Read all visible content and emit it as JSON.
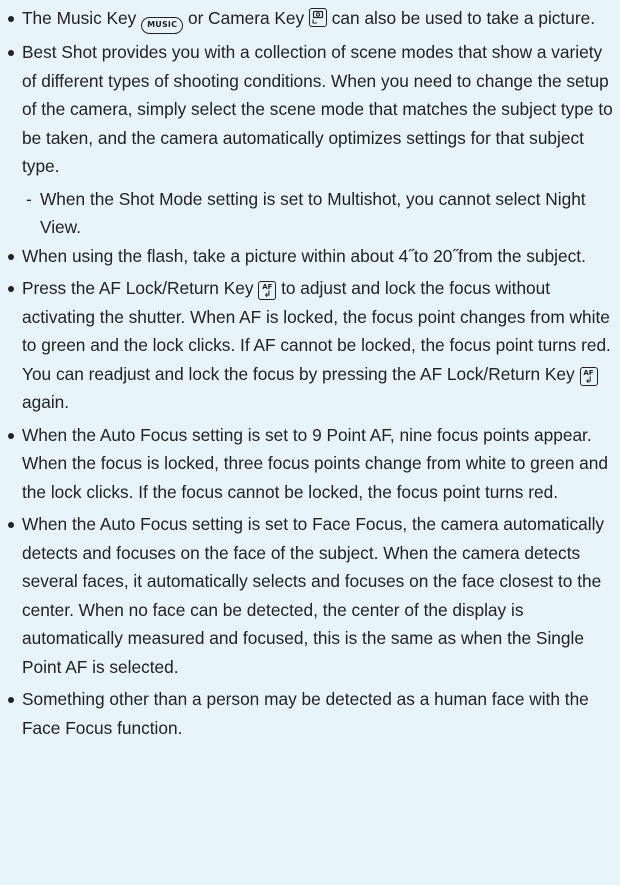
{
  "notes": [
    {
      "text_a": "The Music Key ",
      "key_a": "MUSIC",
      "text_b": " or Camera Key ",
      "text_c": " can also be used to take a picture."
    },
    {
      "text": "Best Shot provides you with a collection of scene modes that show a variety of different types of shooting conditions. When you need to change the setup of the camera, simply select the scene mode that matches the subject type to be taken, and the camera automatically optimizes settings for that subject type.",
      "sub": "When the Shot Mode setting is set to Multishot, you cannot select Night View."
    },
    {
      "text": "When using the flash, take a picture within about 4˝to 20˝from the subject."
    },
    {
      "text_a": "Press the AF Lock/Return Key ",
      "text_b": " to adjust and lock the focus without activating the shutter. When AF is locked, the focus point changes from white to green and the lock clicks. If AF cannot be locked, the focus point turns red. You can readjust and lock the focus by pressing the AF Lock/Return Key ",
      "text_c": " again.",
      "key_af_top": "AF",
      "key_af_arrow": "↲"
    },
    {
      "text": "When the Auto Focus setting is set to 9 Point AF, nine focus points appear. When the focus is locked, three focus points change from white to green and the lock clicks. If the focus cannot be locked, the focus point turns red."
    },
    {
      "text": "When the Auto Focus setting is set to Face Focus, the camera automatically detects and focuses on the face of the subject. When the camera detects several faces, it automatically selects and focuses on the face closest to the center. When no face can be detected, the center of the display is automatically measured and focused, this is the same as when the Single Point AF is selected."
    },
    {
      "text": "Something other than a person may be detected as a human face with the Face Focus function."
    }
  ],
  "sub_dash": "-",
  "icons": {
    "music_key": "music-key-icon",
    "camera_key": "camera-key-icon",
    "af_lock_key": "af-lock-return-key-icon"
  }
}
